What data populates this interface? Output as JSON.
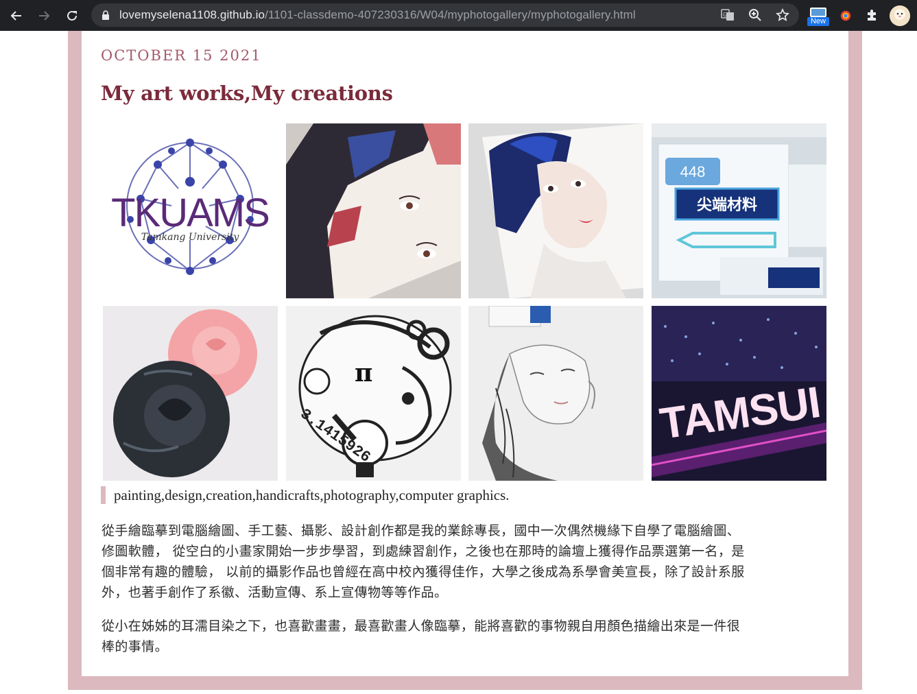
{
  "browser": {
    "url_host": "lovemyselena1108.github.io",
    "url_path": "/1101-classdemo-407230316/W04/myphotogallery/myphotogallery.html",
    "back_icon": "arrow-left-icon",
    "forward_icon": "arrow-right-icon",
    "reload_icon": "reload-icon",
    "lock_icon": "lock-icon",
    "translate_icon": "translate-icon",
    "zoom_icon": "zoom-icon",
    "bookmark_icon": "star-icon",
    "extension_badge_label": "New",
    "extensions_icon": "puzzle-icon"
  },
  "post": {
    "date": "OCTOBER 15 2021",
    "title": "My art works,My creations",
    "gallery": [
      {
        "name": "gallery-tkuams-logo",
        "text": "TKUAMS",
        "subtext": "Tamkang University"
      },
      {
        "name": "gallery-colored-portrait"
      },
      {
        "name": "gallery-bluehair-portrait"
      },
      {
        "name": "gallery-badges",
        "text": "448",
        "subtext": "尖端材料"
      },
      {
        "name": "gallery-paper-roses"
      },
      {
        "name": "gallery-doodle-design",
        "text": "3.1415926"
      },
      {
        "name": "gallery-pencil-sketch"
      },
      {
        "name": "gallery-tamsui-sign",
        "text": "TAMSUI"
      }
    ],
    "caption": "painting,design,creation,handicrafts,photography,computer graphics.",
    "paragraph1_lines": [
      "從手繪臨摹到電腦繪圖、手工藝、攝影、設計創作都是我的業餘專長，國中一次偶然機緣下自學了電腦繪圖、",
      "修圖軟體， 從空白的小畫家開始一步步學習，到處練習創作，之後也在那時的論壇上獲得作品票選第一名，是",
      "個非常有趣的體驗， 以前的攝影作品也曾經在高中校內獲得佳作，大學之後成為系學會美宣長，除了設計系服",
      "外，也著手創作了系徽、活動宣傳、系上宣傳物等等作品。"
    ],
    "paragraph2_lines": [
      "從小在姊姊的耳濡目染之下，也喜歡畫畫，最喜歡畫人像臨摹，能將喜歡的事物親自用顏色描繪出來是一件很",
      "棒的事情。"
    ]
  },
  "colors": {
    "frame": "#dbb9bf",
    "date": "#a3596b",
    "title": "#7b2a3a",
    "chrome": "#202124"
  }
}
